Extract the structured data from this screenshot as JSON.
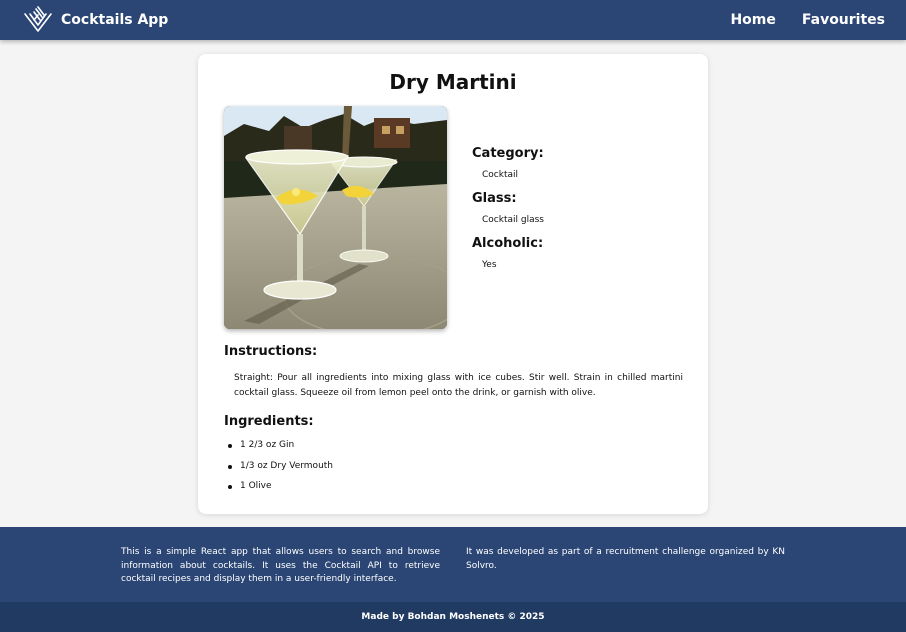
{
  "navbar": {
    "app_title": "Cocktails App",
    "links": [
      {
        "label": "Home"
      },
      {
        "label": "Favourites"
      }
    ]
  },
  "drink": {
    "name": "Dry Martini",
    "category_label": "Category:",
    "category": "Cocktail",
    "glass_label": "Glass:",
    "glass": "Cocktail glass",
    "alcoholic_label": "Alcoholic:",
    "alcoholic": "Yes",
    "instructions_label": "Instructions:",
    "instructions": "Straight: Pour all ingredients into mixing glass with ice cubes. Stir well. Strain in chilled martini cocktail glass. Squeeze oil from lemon peel onto the drink, or garnish with olive.",
    "ingredients_label": "Ingredients:",
    "ingredients": [
      "1 2/3 oz Gin",
      "1/3 oz Dry Vermouth",
      "1 Olive"
    ]
  },
  "footer": {
    "about": "This is a simple React app that allows users to search and browse information about cocktails. It uses the Cocktail API to retrieve cocktail recipes and display them in a user-friendly interface.",
    "challenge": "It was developed as part of a recruitment challenge organized by KN Solvro.",
    "credits": "Made by Bohdan Moshenets © 2025"
  },
  "colors": {
    "navbar": "#2b4675",
    "footer": "#2b4675",
    "bottom_bar": "#213a62",
    "background": "#f4f4f4"
  },
  "icons": {
    "logo": "cocktail-logo-icon"
  }
}
